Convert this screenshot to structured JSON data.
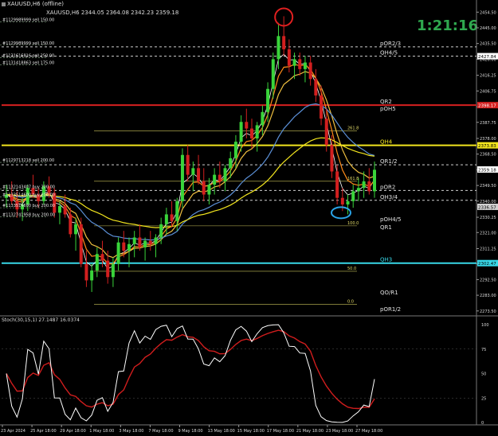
{
  "window": {
    "title": "XAUUSD,H6 (offline)",
    "ohlc": "XAUUSD,H6  2344.05 2364.08 2342.23 2359.18",
    "timer": "1:21:16"
  },
  "stoch_label": "Stoch(30,15,1) 27.1487 16.0374",
  "colors": {
    "background": "#000000",
    "candle_up": "#39d43a",
    "candle_down": "#d21f1f",
    "level_red": "#d62020",
    "level_yellow": "#f2e51e",
    "level_cyan": "#38d8e8",
    "stoch_main": "#ffffff",
    "stoch_signal": "#d01d1d"
  },
  "chart_data": {
    "type": "candlestick",
    "price_axis": {
      "ylim": [
        2271.0,
        2458.0
      ],
      "ticks": [
        "2454.50",
        "2445.00",
        "2435.50",
        "2426.00",
        "2416.25",
        "2406.75",
        "2397.25",
        "2387.75",
        "2378.00",
        "2368.50",
        "2359.00",
        "2349.50",
        "2340.00",
        "2330.25",
        "2321.00",
        "2311.25",
        "2302.00",
        "2292.50",
        "2283.00",
        "2273.50"
      ],
      "marked_labels": [
        {
          "price": "2427.84",
          "color": "#ffffff",
          "bg": "#ffffff"
        },
        {
          "price": "2398.17",
          "color": "#ffffff",
          "bg": "#d62020"
        },
        {
          "price": "2373.83",
          "color": "#000000",
          "bg": "#f2e51e"
        },
        {
          "price": "2359.18",
          "color": "#000000",
          "bg": "#ffffff"
        },
        {
          "price": "2336.57",
          "color": "#000000",
          "bg": "#d0d0d0"
        },
        {
          "price": "2302.47",
          "color": "#000000",
          "bg": "#38d8e8"
        }
      ]
    },
    "time_axis": {
      "ticks": [
        "23 Apr 2024",
        "25 Apr 18:00",
        "29 Apr 18:00",
        "1 May 18:00",
        "3 May 18:00",
        "7 May 18:00",
        "9 May 18:00",
        "13 May 18:00",
        "15 May 18:00",
        "17 May 18:00",
        "21 May 18:00",
        "23 May 18:00",
        "27 May 18:00"
      ]
    },
    "levels": [
      {
        "label": "pOR2/3",
        "price": 2433.5,
        "color": "#d0d0d0",
        "style": "dashed"
      },
      {
        "label": "QH4/5",
        "price": 2427.84,
        "color": "#d0d0d0",
        "style": "dashed"
      },
      {
        "label": "QR2",
        "price": 2398.17,
        "color": "#d62020",
        "style": "solid"
      },
      {
        "label": "pOH5",
        "price": 2394.0,
        "color": "#d0d0d0",
        "style": "none"
      },
      {
        "label": "QH4",
        "price": 2373.83,
        "color": "#f2e51e",
        "style": "solid"
      },
      {
        "label": "QR1/2",
        "price": 2362.0,
        "color": "#d0d0d0",
        "style": "dashed"
      },
      {
        "label": "pOR2",
        "price": 2346.5,
        "color": "#d0d0d0",
        "style": "dashed"
      },
      {
        "label": "QH3/4",
        "price": 2340.5,
        "color": "#d0d0d0",
        "style": "dashed"
      },
      {
        "label": "pOH4/5",
        "price": 2327.0,
        "color": "#d0d0d0",
        "style": "none"
      },
      {
        "label": "QR1",
        "price": 2322.0,
        "color": "#d62020",
        "style": "none"
      },
      {
        "label": "QH3",
        "price": 2302.47,
        "color": "#38d8e8",
        "style": "solid"
      },
      {
        "label": "QO/R1",
        "price": 2282.5,
        "color": "#d0d0d0",
        "style": "none"
      },
      {
        "label": "pOR1/2",
        "price": 2272.5,
        "color": "#d0d0d0",
        "style": "none"
      }
    ],
    "left_labels": [
      {
        "text": "#1129989999 sell 150.00",
        "price": 2448.5
      },
      {
        "text": "#1129989999 sell 150.00",
        "price": 2434.5
      },
      {
        "text": "#1131616816 sell 250.00",
        "price": 2427.0
      },
      {
        "text": "#1131418863 sell 175.00",
        "price": 2422.5
      },
      {
        "text": "#1129713218 sell 200.00",
        "price": 2363.5
      },
      {
        "text": "#1132143407 buy 200.00",
        "price": 2347.5
      },
      {
        "text": "#1133514600 buy 200.00",
        "price": 2342.5
      },
      {
        "text": "#1133514600 buy 200.00",
        "price": 2336.0
      },
      {
        "text": "#1132741958 buy 200.00",
        "price": 2330.5
      }
    ],
    "fib_labels": [
      {
        "text": "261.8",
        "price": 2383.5
      },
      {
        "text": "161.8",
        "price": 2353.0
      },
      {
        "text": "100.0",
        "price": 2326.0
      },
      {
        "text": "50.0",
        "price": 2298.5
      },
      {
        "text": "0.0",
        "price": 2278.5
      }
    ],
    "candles_ohlc": [
      [
        2342,
        2350,
        2336,
        2344
      ],
      [
        2344,
        2352,
        2338,
        2340
      ],
      [
        2340,
        2346,
        2330,
        2335
      ],
      [
        2335,
        2342,
        2328,
        2338
      ],
      [
        2338,
        2350,
        2334,
        2348
      ],
      [
        2348,
        2356,
        2342,
        2344
      ],
      [
        2344,
        2348,
        2336,
        2340
      ],
      [
        2340,
        2352,
        2338,
        2349
      ],
      [
        2349,
        2355,
        2342,
        2345
      ],
      [
        2345,
        2348,
        2330,
        2333
      ],
      [
        2333,
        2340,
        2326,
        2337
      ],
      [
        2337,
        2344,
        2330,
        2332
      ],
      [
        2332,
        2336,
        2318,
        2320
      ],
      [
        2320,
        2330,
        2310,
        2326
      ],
      [
        2326,
        2330,
        2300,
        2302
      ],
      [
        2302,
        2310,
        2288,
        2292
      ],
      [
        2292,
        2302,
        2285,
        2298
      ],
      [
        2298,
        2312,
        2294,
        2308
      ],
      [
        2308,
        2316,
        2300,
        2304
      ],
      [
        2304,
        2310,
        2290,
        2294
      ],
      [
        2294,
        2306,
        2288,
        2302
      ],
      [
        2302,
        2318,
        2298,
        2315
      ],
      [
        2315,
        2322,
        2306,
        2310
      ],
      [
        2310,
        2318,
        2300,
        2314
      ],
      [
        2314,
        2322,
        2306,
        2318
      ],
      [
        2318,
        2326,
        2310,
        2312
      ],
      [
        2312,
        2318,
        2304,
        2316
      ],
      [
        2316,
        2322,
        2310,
        2314
      ],
      [
        2314,
        2320,
        2306,
        2318
      ],
      [
        2318,
        2330,
        2314,
        2326
      ],
      [
        2326,
        2336,
        2320,
        2332
      ],
      [
        2332,
        2340,
        2324,
        2328
      ],
      [
        2328,
        2342,
        2322,
        2340
      ],
      [
        2340,
        2372,
        2336,
        2368
      ],
      [
        2368,
        2374,
        2352,
        2356
      ],
      [
        2356,
        2364,
        2346,
        2360
      ],
      [
        2360,
        2368,
        2350,
        2352
      ],
      [
        2352,
        2360,
        2340,
        2344
      ],
      [
        2344,
        2354,
        2338,
        2350
      ],
      [
        2350,
        2360,
        2344,
        2356
      ],
      [
        2356,
        2364,
        2348,
        2352
      ],
      [
        2352,
        2362,
        2346,
        2360
      ],
      [
        2360,
        2370,
        2354,
        2366
      ],
      [
        2366,
        2380,
        2360,
        2376
      ],
      [
        2376,
        2392,
        2370,
        2388
      ],
      [
        2388,
        2396,
        2378,
        2384
      ],
      [
        2384,
        2390,
        2372,
        2378
      ],
      [
        2378,
        2388,
        2370,
        2386
      ],
      [
        2386,
        2398,
        2380,
        2394
      ],
      [
        2394,
        2412,
        2388,
        2408
      ],
      [
        2408,
        2430,
        2402,
        2426
      ],
      [
        2426,
        2448,
        2420,
        2440
      ],
      [
        2440,
        2452,
        2428,
        2432
      ],
      [
        2432,
        2438,
        2418,
        2422
      ],
      [
        2422,
        2430,
        2414,
        2426
      ],
      [
        2426,
        2430,
        2416,
        2420
      ],
      [
        2420,
        2428,
        2412,
        2424
      ],
      [
        2424,
        2428,
        2410,
        2414
      ],
      [
        2414,
        2420,
        2400,
        2404
      ],
      [
        2404,
        2410,
        2386,
        2390
      ],
      [
        2390,
        2396,
        2370,
        2374
      ],
      [
        2374,
        2380,
        2354,
        2358
      ],
      [
        2358,
        2362,
        2338,
        2342
      ],
      [
        2342,
        2348,
        2334,
        2338
      ],
      [
        2338,
        2344,
        2332,
        2340
      ],
      [
        2340,
        2350,
        2336,
        2346
      ],
      [
        2346,
        2354,
        2340,
        2348
      ],
      [
        2348,
        2358,
        2342,
        2352
      ],
      [
        2352,
        2360,
        2344,
        2346
      ],
      [
        2346,
        2364,
        2342,
        2359
      ]
    ],
    "stoch_axis": {
      "ylim": [
        0,
        100
      ],
      "ticks": [
        "100",
        "75",
        "50",
        "25",
        "0"
      ]
    }
  }
}
